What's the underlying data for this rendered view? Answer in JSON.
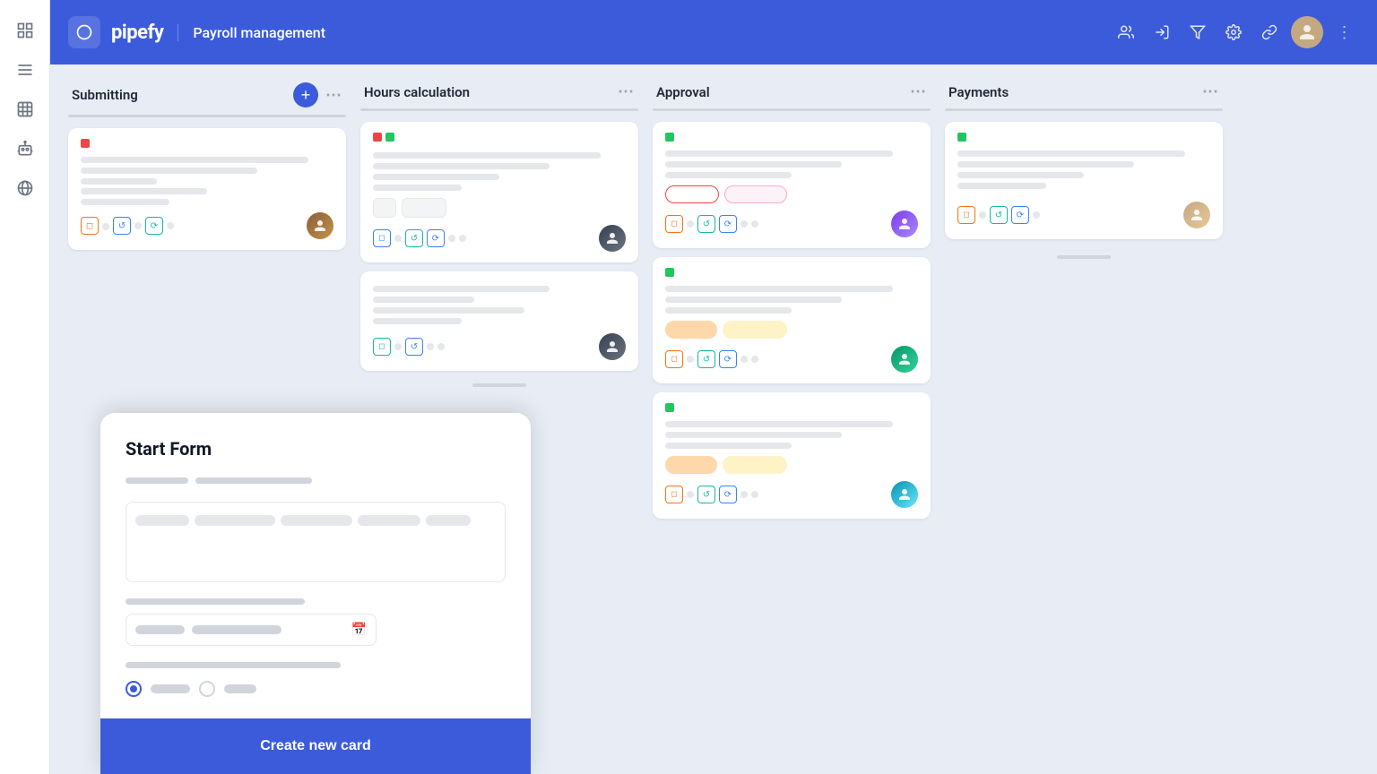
{
  "app": {
    "name": "pipefy",
    "page_title": "Payroll management"
  },
  "sidebar": {
    "icons": [
      "grid",
      "list",
      "table",
      "robot",
      "globe"
    ]
  },
  "header": {
    "actions": [
      "people",
      "login",
      "filter",
      "settings",
      "link"
    ]
  },
  "columns": [
    {
      "id": "submitting",
      "title": "Submitting",
      "has_add": true,
      "cards": [
        {
          "dot_color": "red",
          "lines": [
            "long",
            "medium",
            "xshort",
            "short",
            "xshort"
          ],
          "avatar_type": "brown",
          "icons": [
            "orange",
            "blue",
            "teal",
            "dot",
            "dot",
            "dot"
          ]
        }
      ]
    },
    {
      "id": "hours_calculation",
      "title": "Hours calculation",
      "has_add": false,
      "cards": [
        {
          "dots": [
            "red",
            "green"
          ],
          "lines": [
            "long",
            "medium",
            "short",
            "xshort",
            "short"
          ],
          "badge": true,
          "avatar_type": "dark",
          "icons": [
            "blue",
            "dot",
            "teal",
            "blue",
            "dot",
            "dot"
          ]
        },
        {
          "dots": [],
          "lines": [
            "medium",
            "xshort",
            "medium",
            "xshort"
          ],
          "badge": false,
          "avatar_type": "dark2",
          "icons": [
            "teal",
            "dot",
            "blue",
            "dot",
            "dot"
          ]
        }
      ]
    },
    {
      "id": "approval",
      "title": "Approval",
      "has_add": false,
      "cards": [
        {
          "dot_color": "green",
          "badges": [
            "outline-red",
            "fill-pink"
          ],
          "avatar_type": "purple"
        },
        {
          "dot_color": "green",
          "badges": [
            "solid-orange",
            "solid-yellow"
          ],
          "avatar_type": "green"
        },
        {
          "dot_color": "green",
          "badges": [
            "solid-orange",
            "solid-yellow"
          ],
          "avatar_type": "teal2"
        }
      ]
    },
    {
      "id": "payments",
      "title": "Payments",
      "has_add": false,
      "cards": [
        {
          "dot_color": "green",
          "avatar_type": "blonde"
        }
      ]
    }
  ],
  "start_form": {
    "title": "Start Form",
    "field1_label": "",
    "textarea_content": "",
    "date_label": "",
    "date_placeholder": "",
    "radio_option1": "",
    "radio_option2": "",
    "cta_label": "Create new card"
  }
}
